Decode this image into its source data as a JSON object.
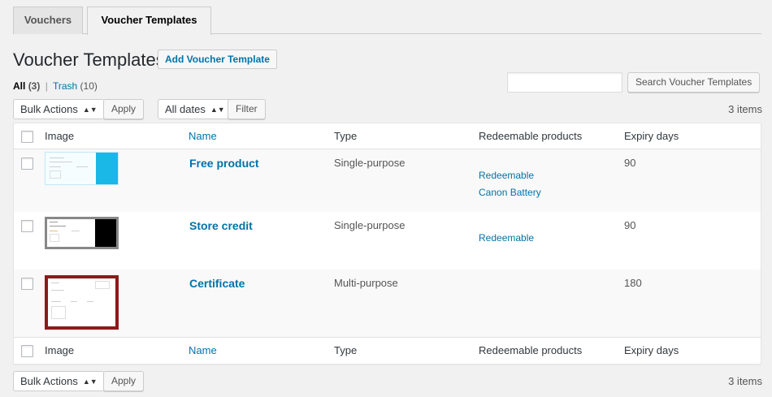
{
  "tabs": [
    {
      "label": "Vouchers",
      "active": false
    },
    {
      "label": "Voucher Templates",
      "active": true
    }
  ],
  "header": {
    "title": "Voucher Templates",
    "add_button": "Add Voucher Template"
  },
  "filters": {
    "all_label": "All",
    "all_count": "(3)",
    "separator": "|",
    "trash_label": "Trash",
    "trash_count": "(10)"
  },
  "search": {
    "value": "",
    "button": "Search Voucher Templates"
  },
  "top_nav": {
    "bulk_actions": "Bulk Actions",
    "apply": "Apply",
    "dates": "All dates",
    "filter": "Filter",
    "items_count": "3 items"
  },
  "bottom_nav": {
    "bulk_actions": "Bulk Actions",
    "apply": "Apply",
    "items_count": "3 items"
  },
  "table": {
    "columns": [
      "Image",
      "Name",
      "Type",
      "Redeemable products",
      "Expiry days"
    ],
    "rows": [
      {
        "name": "Free product",
        "type": "Single-purpose",
        "products": [
          "Redeemable",
          "Canon Battery"
        ],
        "expiry": "90"
      },
      {
        "name": "Store credit",
        "type": "Single-purpose",
        "products": [
          "Redeemable"
        ],
        "expiry": "90"
      },
      {
        "name": "Certificate",
        "type": "Multi-purpose",
        "products": [],
        "expiry": "180"
      }
    ]
  },
  "colors": {
    "link": "#0073aa",
    "accent_cyan": "#19b8e6",
    "certificate_border": "#8b1a1a"
  }
}
